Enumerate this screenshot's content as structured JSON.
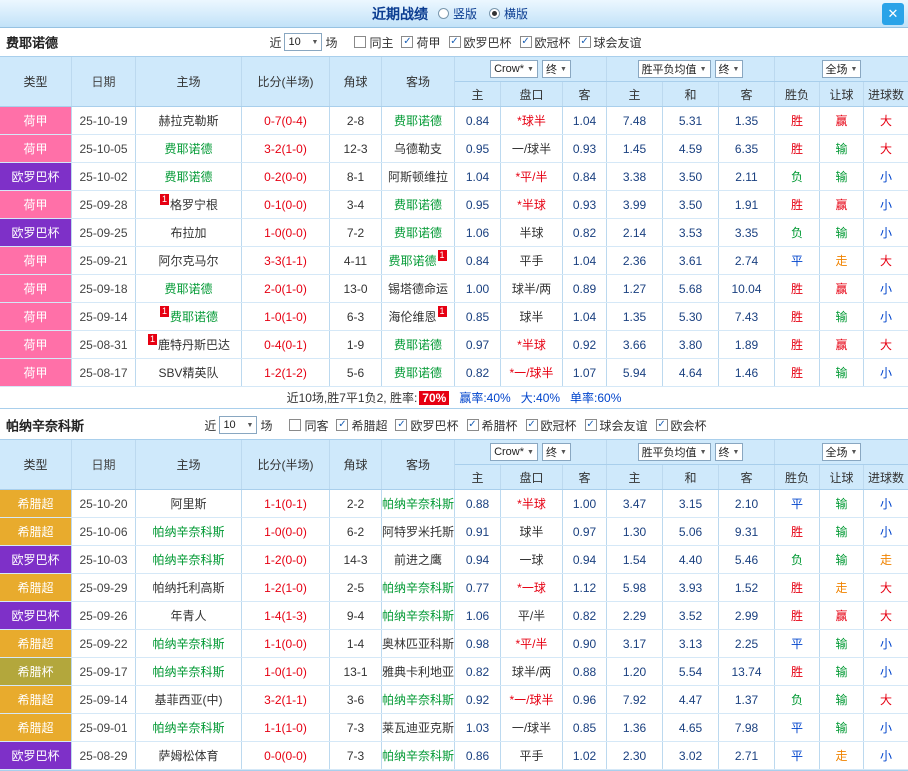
{
  "topbar": {
    "title": "近期战绩",
    "vertical": "竖版",
    "horizontal": "横版",
    "selected": "横版"
  },
  "glyphs": {
    "close": "✕",
    "check": "✓",
    "arrow": "▼",
    "red_card": "1"
  },
  "controls": {
    "near": "近",
    "count": "10",
    "games": "场",
    "odds_source": "Crow*",
    "final": "终",
    "mean": "胜平负均值",
    "scope": "全场"
  },
  "columns": {
    "type": "类型",
    "date": "日期",
    "home": "主场",
    "score": "比分(半场)",
    "corner": "角球",
    "away": "客场",
    "o_home": "主",
    "handicap": "盘口",
    "o_away": "客",
    "m_home": "主",
    "m_draw": "和",
    "m_away": "客",
    "wdl": "胜负",
    "let_goal": "让球",
    "goals": "进球数"
  },
  "colors": {
    "score_red": "#e60012",
    "team_green": "#009933",
    "odds": "#1a4080",
    "handicap_black": "#333333",
    "rate_badge_bg": "#e60012",
    "summary_blue": "#0044cc"
  },
  "league_colors": {
    "荷甲": "#ff70a8",
    "欧罗巴杯": "#7e30c8",
    "希腊超": "#e8ab2d",
    "希腊杯": "#b3a73c"
  },
  "result_colors": {
    "胜": "#e60012",
    "赢": "#e60012",
    "大": "#e60012",
    "负": "#009933",
    "输": "#009933",
    "平": "#0044cc",
    "小": "#0044cc",
    "走": "#f08300"
  },
  "sections": [
    {
      "team": "费耶诺德",
      "filters": [
        {
          "label": "同主",
          "checked": false
        },
        {
          "label": "荷甲",
          "checked": true
        },
        {
          "label": "欧罗巴杯",
          "checked": true
        },
        {
          "label": "欧冠杯",
          "checked": true
        },
        {
          "label": "球会友谊",
          "checked": true
        }
      ],
      "rows": [
        {
          "lg": "荷甲",
          "dt": "25-10-19",
          "h": "赫拉克勒斯",
          "hg": 0,
          "s": "0-7(0-4)",
          "cn": "2-8",
          "a": "费耶诺德",
          "ag": 1,
          "oh": "0.84",
          "hc": "*球半",
          "oa": "1.04",
          "mh": "7.48",
          "md": "5.31",
          "ma": "1.35",
          "rw": "胜",
          "rh": "赢",
          "rg": "大"
        },
        {
          "lg": "荷甲",
          "dt": "25-10-05",
          "h": "费耶诺德",
          "hg": 1,
          "s": "3-2(1-0)",
          "cn": "12-3",
          "a": "乌德勒支",
          "ag": 0,
          "oh": "0.95",
          "hc": "一/球半",
          "oa": "0.93",
          "mh": "1.45",
          "md": "4.59",
          "ma": "6.35",
          "rw": "胜",
          "rh": "输",
          "rg": "大"
        },
        {
          "lg": "欧罗巴杯",
          "dt": "25-10-02",
          "h": "费耶诺德",
          "hg": 1,
          "s": "0-2(0-0)",
          "cn": "8-1",
          "a": "阿斯顿维拉",
          "ag": 0,
          "oh": "1.04",
          "hc": "*平/半",
          "oa": "0.84",
          "mh": "3.38",
          "md": "3.50",
          "ma": "2.11",
          "rw": "负",
          "rh": "输",
          "rg": "小"
        },
        {
          "lg": "荷甲",
          "dt": "25-09-28",
          "h": "格罗宁根",
          "hg": 0,
          "hb": "l",
          "s": "0-1(0-0)",
          "cn": "3-4",
          "a": "费耶诺德",
          "ag": 1,
          "oh": "0.95",
          "hc": "*半球",
          "oa": "0.93",
          "mh": "3.99",
          "md": "3.50",
          "ma": "1.91",
          "rw": "胜",
          "rh": "赢",
          "rg": "小"
        },
        {
          "lg": "欧罗巴杯",
          "dt": "25-09-25",
          "h": "布拉加",
          "hg": 0,
          "s": "1-0(0-0)",
          "cn": "7-2",
          "a": "费耶诺德",
          "ag": 1,
          "oh": "1.06",
          "hc": "半球",
          "oa": "0.82",
          "mh": "2.14",
          "md": "3.53",
          "ma": "3.35",
          "rw": "负",
          "rh": "输",
          "rg": "小"
        },
        {
          "lg": "荷甲",
          "dt": "25-09-21",
          "h": "阿尔克马尔",
          "hg": 0,
          "s": "3-3(1-1)",
          "cn": "4-11",
          "a": "费耶诺德",
          "ag": 1,
          "ab": "r",
          "oh": "0.84",
          "hc": "平手",
          "oa": "1.04",
          "mh": "2.36",
          "md": "3.61",
          "ma": "2.74",
          "rw": "平",
          "rh": "走",
          "rg": "大"
        },
        {
          "lg": "荷甲",
          "dt": "25-09-18",
          "h": "费耶诺德",
          "hg": 1,
          "s": "2-0(1-0)",
          "cn": "13-0",
          "a": "锡塔德命运",
          "ag": 0,
          "oh": "1.00",
          "hc": "球半/两",
          "oa": "0.89",
          "mh": "1.27",
          "md": "5.68",
          "ma": "10.04",
          "rw": "胜",
          "rh": "赢",
          "rg": "小"
        },
        {
          "lg": "荷甲",
          "dt": "25-09-14",
          "h": "费耶诺德",
          "hg": 1,
          "hb": "l",
          "s": "1-0(1-0)",
          "cn": "6-3",
          "a": "海伦维恩",
          "ag": 0,
          "ab": "r",
          "oh": "0.85",
          "hc": "球半",
          "oa": "1.04",
          "mh": "1.35",
          "md": "5.30",
          "ma": "7.43",
          "rw": "胜",
          "rh": "输",
          "rg": "小"
        },
        {
          "lg": "荷甲",
          "dt": "25-08-31",
          "h": "鹿特丹斯巴达",
          "hg": 0,
          "hb": "l",
          "s": "0-4(0-1)",
          "cn": "1-9",
          "a": "费耶诺德",
          "ag": 1,
          "oh": "0.97",
          "hc": "*半球",
          "oa": "0.92",
          "mh": "3.66",
          "md": "3.80",
          "ma": "1.89",
          "rw": "胜",
          "rh": "赢",
          "rg": "大"
        },
        {
          "lg": "荷甲",
          "dt": "25-08-17",
          "h": "SBV精英队",
          "hg": 0,
          "s": "1-2(1-2)",
          "cn": "5-6",
          "a": "费耶诺德",
          "ag": 1,
          "oh": "0.82",
          "hc": "*一/球半",
          "oa": "1.07",
          "mh": "5.94",
          "md": "4.64",
          "ma": "1.46",
          "rw": "胜",
          "rh": "输",
          "rg": "小"
        }
      ],
      "summary": {
        "lead": "近10场,胜7平1负2, 胜率:",
        "rate": "70%",
        "r1": "赢率:40%",
        "r2": "大:40%",
        "r3": "单率:60%"
      }
    },
    {
      "team": "帕纳辛奈科斯",
      "filters": [
        {
          "label": "同客",
          "checked": false
        },
        {
          "label": "希腊超",
          "checked": true
        },
        {
          "label": "欧罗巴杯",
          "checked": true
        },
        {
          "label": "希腊杯",
          "checked": true
        },
        {
          "label": "欧冠杯",
          "checked": true
        },
        {
          "label": "球会友谊",
          "checked": true
        },
        {
          "label": "欧会杯",
          "checked": true
        }
      ],
      "rows": [
        {
          "lg": "希腊超",
          "dt": "25-10-20",
          "h": "阿里斯",
          "hg": 0,
          "s": "1-1(0-1)",
          "cn": "2-2",
          "a": "帕纳辛奈科斯",
          "ag": 1,
          "oh": "0.88",
          "hc": "*半球",
          "oa": "1.00",
          "mh": "3.47",
          "md": "3.15",
          "ma": "2.10",
          "rw": "平",
          "rh": "输",
          "rg": "小"
        },
        {
          "lg": "希腊超",
          "dt": "25-10-06",
          "h": "帕纳辛奈科斯",
          "hg": 1,
          "s": "1-0(0-0)",
          "cn": "6-2",
          "a": "阿特罗米托斯",
          "ag": 0,
          "oh": "0.91",
          "hc": "球半",
          "oa": "0.97",
          "mh": "1.30",
          "md": "5.06",
          "ma": "9.31",
          "rw": "胜",
          "rh": "输",
          "rg": "小"
        },
        {
          "lg": "欧罗巴杯",
          "dt": "25-10-03",
          "h": "帕纳辛奈科斯",
          "hg": 1,
          "s": "1-2(0-0)",
          "cn": "14-3",
          "a": "前进之鹰",
          "ag": 0,
          "oh": "0.94",
          "hc": "一球",
          "oa": "0.94",
          "mh": "1.54",
          "md": "4.40",
          "ma": "5.46",
          "rw": "负",
          "rh": "输",
          "rg": "走"
        },
        {
          "lg": "希腊超",
          "dt": "25-09-29",
          "h": "帕纳托利高斯",
          "hg": 0,
          "s": "1-2(1-0)",
          "cn": "2-5",
          "a": "帕纳辛奈科斯",
          "ag": 1,
          "oh": "0.77",
          "hc": "*一球",
          "oa": "1.12",
          "mh": "5.98",
          "md": "3.93",
          "ma": "1.52",
          "rw": "胜",
          "rh": "走",
          "rg": "大"
        },
        {
          "lg": "欧罗巴杯",
          "dt": "25-09-26",
          "h": "年青人",
          "hg": 0,
          "s": "1-4(1-3)",
          "cn": "9-4",
          "a": "帕纳辛奈科斯",
          "ag": 1,
          "oh": "1.06",
          "hc": "平/半",
          "oa": "0.82",
          "mh": "2.29",
          "md": "3.52",
          "ma": "2.99",
          "rw": "胜",
          "rh": "赢",
          "rg": "大"
        },
        {
          "lg": "希腊超",
          "dt": "25-09-22",
          "h": "帕纳辛奈科斯",
          "hg": 1,
          "s": "1-1(0-0)",
          "cn": "1-4",
          "a": "奥林匹亚科斯",
          "ag": 0,
          "oh": "0.98",
          "hc": "*平/半",
          "oa": "0.90",
          "mh": "3.17",
          "md": "3.13",
          "ma": "2.25",
          "rw": "平",
          "rh": "输",
          "rg": "小"
        },
        {
          "lg": "希腊杯",
          "dt": "25-09-17",
          "h": "帕纳辛奈科斯",
          "hg": 1,
          "s": "1-0(1-0)",
          "cn": "13-1",
          "a": "雅典卡利地亚",
          "ag": 0,
          "oh": "0.82",
          "hc": "球半/两",
          "oa": "0.88",
          "mh": "1.20",
          "md": "5.54",
          "ma": "13.74",
          "rw": "胜",
          "rh": "输",
          "rg": "小"
        },
        {
          "lg": "希腊超",
          "dt": "25-09-14",
          "h": "基菲西亚(中)",
          "hg": 0,
          "s": "3-2(1-1)",
          "cn": "3-6",
          "a": "帕纳辛奈科斯",
          "ag": 1,
          "oh": "0.92",
          "hc": "*一/球半",
          "oa": "0.96",
          "mh": "7.92",
          "md": "4.47",
          "ma": "1.37",
          "rw": "负",
          "rh": "输",
          "rg": "大"
        },
        {
          "lg": "希腊超",
          "dt": "25-09-01",
          "h": "帕纳辛奈科斯",
          "hg": 1,
          "s": "1-1(1-0)",
          "cn": "7-3",
          "a": "莱瓦迪亚克斯",
          "ag": 0,
          "oh": "1.03",
          "hc": "一/球半",
          "oa": "0.85",
          "mh": "1.36",
          "md": "4.65",
          "ma": "7.98",
          "rw": "平",
          "rh": "输",
          "rg": "小"
        },
        {
          "lg": "欧罗巴杯",
          "dt": "25-08-29",
          "h": "萨姆松体育",
          "hg": 0,
          "s": "0-0(0-0)",
          "cn": "7-3",
          "a": "帕纳辛奈科斯",
          "ag": 1,
          "oh": "0.86",
          "hc": "平手",
          "oa": "1.02",
          "mh": "2.30",
          "md": "3.02",
          "ma": "2.71",
          "rw": "平",
          "rh": "走",
          "rg": "小"
        }
      ]
    }
  ]
}
